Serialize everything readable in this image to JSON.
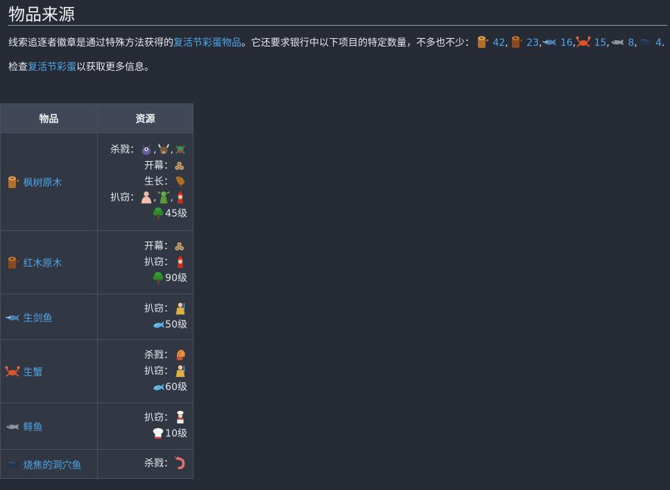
{
  "page": {
    "title": "物品来源"
  },
  "intro": {
    "text1": "线索追逐者徽章是通过特殊方法获得的",
    "link1": "复活节彩蛋物品",
    "text2": "。它还要求银行中以下项目的特定数量，不多也不少：",
    "counts": [
      {
        "icon": "maple-log-icon",
        "value": "42",
        "sep": ","
      },
      {
        "icon": "mahogany-log-icon",
        "value": "23",
        "sep": ","
      },
      {
        "icon": "raw-swordfish-icon",
        "value": "16",
        "sep": ","
      },
      {
        "icon": "raw-crab-icon",
        "value": "15",
        "sep": ","
      },
      {
        "icon": "raw-pike-icon",
        "value": "8",
        "sep": ","
      },
      {
        "icon": "burnt-cave-fish-icon",
        "value": "4",
        "sep": "."
      }
    ]
  },
  "note": {
    "text1": "检查",
    "link": "复活节彩蛋",
    "text2": "以获取更多信息。"
  },
  "table": {
    "headers": {
      "item": "物品",
      "source": "资源"
    },
    "rows": [
      {
        "item": "枫树原木",
        "icon": "maple-log-icon",
        "lines": [
          {
            "label": "杀戮：",
            "icons": [
              "purple-monster-icon",
              "horned-beast-icon",
              "green-creature-icon"
            ]
          },
          {
            "label": "开幕：",
            "icons": [
              "log-pile-icon"
            ]
          },
          {
            "label": "生长：",
            "icons": [
              "maple-seed-icon"
            ]
          },
          {
            "label": "扒窃：",
            "icons": [
              "pink-man-icon",
              "goblin-icon",
              "red-gnome-icon"
            ]
          },
          {
            "label": "",
            "icons": [
              "woodcutting-icon"
            ],
            "level": "45级"
          }
        ]
      },
      {
        "item": "红木原木",
        "icon": "mahogany-log-icon",
        "lines": [
          {
            "label": "开幕：",
            "icons": [
              "log-pile-icon"
            ]
          },
          {
            "label": "扒窃：",
            "icons": [
              "red-gnome-icon"
            ]
          },
          {
            "label": "",
            "icons": [
              "woodcutting-icon"
            ],
            "level": "90级"
          }
        ]
      },
      {
        "item": "生剑鱼",
        "icon": "raw-swordfish-icon",
        "lines": [
          {
            "label": "扒窃：",
            "icons": [
              "fisherman-icon"
            ]
          },
          {
            "label": "",
            "icons": [
              "fishing-icon"
            ],
            "level": "50级"
          }
        ]
      },
      {
        "item": "生蟹",
        "icon": "raw-crab-icon",
        "lines": [
          {
            "label": "杀戮：",
            "icons": [
              "hermit-crab-icon"
            ]
          },
          {
            "label": "扒窃：",
            "icons": [
              "fisherman-icon"
            ]
          },
          {
            "label": "",
            "icons": [
              "fishing-icon"
            ],
            "level": "60级"
          }
        ]
      },
      {
        "item": "鲱鱼",
        "icon": "raw-pike-icon",
        "lines": [
          {
            "label": "扒窃：",
            "icons": [
              "chef-icon"
            ]
          },
          {
            "label": "",
            "icons": [
              "cooking-icon"
            ],
            "level": "10级"
          }
        ]
      },
      {
        "item": "烧焦的洞穴鱼",
        "icon": "burnt-cave-fish-icon",
        "lines": [
          {
            "label": "杀戮：",
            "icons": [
              "cave-shrimp-icon"
            ]
          }
        ]
      }
    ]
  },
  "colors": {
    "background": "#272b36",
    "link": "#4ea6ea",
    "table_header": "#404858"
  }
}
